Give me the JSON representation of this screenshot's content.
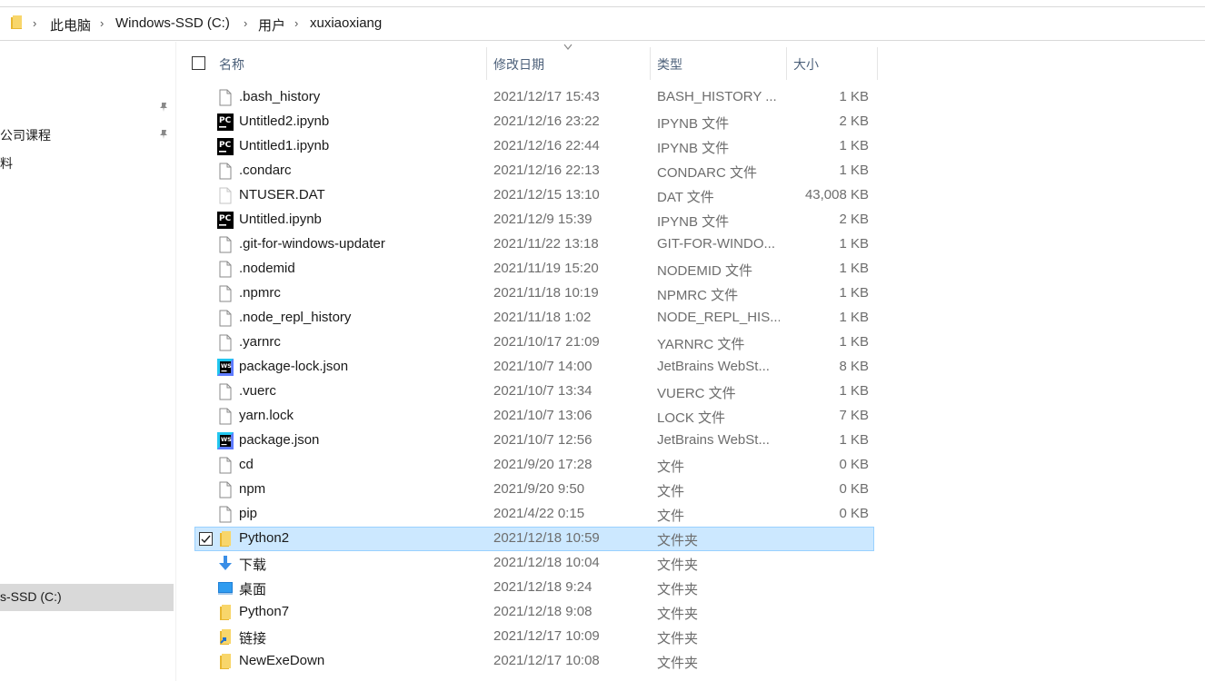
{
  "breadcrumb": [
    "此电脑",
    "Windows-SSD (C:)",
    "用户",
    "xuxiaoxiang"
  ],
  "nav": {
    "items": [
      "公司课程",
      "料"
    ],
    "selected": "s-SSD (C:)"
  },
  "columns": {
    "name": "名称",
    "date": "修改日期",
    "type": "类型",
    "size": "大小"
  },
  "files": [
    {
      "name": ".bash_history",
      "date": "2021/12/17 15:43",
      "type": "BASH_HISTORY ...",
      "size": "1 KB",
      "icon": "generic-file-icon"
    },
    {
      "name": "Untitled2.ipynb",
      "date": "2021/12/16 23:22",
      "type": "IPYNB 文件",
      "size": "2 KB",
      "icon": "pycharm-file-icon"
    },
    {
      "name": "Untitled1.ipynb",
      "date": "2021/12/16 22:44",
      "type": "IPYNB 文件",
      "size": "1 KB",
      "icon": "pycharm-file-icon"
    },
    {
      "name": ".condarc",
      "date": "2021/12/16 22:13",
      "type": "CONDARC 文件",
      "size": "1 KB",
      "icon": "generic-file-icon"
    },
    {
      "name": "NTUSER.DAT",
      "date": "2021/12/15 13:10",
      "type": "DAT 文件",
      "size": "43,008 KB",
      "icon": "system-file-icon"
    },
    {
      "name": "Untitled.ipynb",
      "date": "2021/12/9 15:39",
      "type": "IPYNB 文件",
      "size": "2 KB",
      "icon": "pycharm-file-icon"
    },
    {
      "name": ".git-for-windows-updater",
      "date": "2021/11/22 13:18",
      "type": "GIT-FOR-WINDO...",
      "size": "1 KB",
      "icon": "generic-file-icon"
    },
    {
      "name": ".nodemid",
      "date": "2021/11/19 15:20",
      "type": "NODEMID 文件",
      "size": "1 KB",
      "icon": "generic-file-icon"
    },
    {
      "name": ".npmrc",
      "date": "2021/11/18 10:19",
      "type": "NPMRC 文件",
      "size": "1 KB",
      "icon": "generic-file-icon"
    },
    {
      "name": ".node_repl_history",
      "date": "2021/11/18 1:02",
      "type": "NODE_REPL_HIS...",
      "size": "1 KB",
      "icon": "generic-file-icon"
    },
    {
      "name": ".yarnrc",
      "date": "2021/10/17 21:09",
      "type": "YARNRC 文件",
      "size": "1 KB",
      "icon": "generic-file-icon"
    },
    {
      "name": "package-lock.json",
      "date": "2021/10/7 14:00",
      "type": "JetBrains WebSt...",
      "size": "8 KB",
      "icon": "webstorm-file-icon"
    },
    {
      "name": ".vuerc",
      "date": "2021/10/7 13:34",
      "type": "VUERC 文件",
      "size": "1 KB",
      "icon": "generic-file-icon"
    },
    {
      "name": "yarn.lock",
      "date": "2021/10/7 13:06",
      "type": "LOCK 文件",
      "size": "7 KB",
      "icon": "generic-file-icon"
    },
    {
      "name": "package.json",
      "date": "2021/10/7 12:56",
      "type": "JetBrains WebSt...",
      "size": "1 KB",
      "icon": "webstorm-file-icon"
    },
    {
      "name": "cd",
      "date": "2021/9/20 17:28",
      "type": "文件",
      "size": "0 KB",
      "icon": "generic-file-icon"
    },
    {
      "name": "npm",
      "date": "2021/9/20 9:50",
      "type": "文件",
      "size": "0 KB",
      "icon": "generic-file-icon"
    },
    {
      "name": "pip",
      "date": "2021/4/22 0:15",
      "type": "文件",
      "size": "0 KB",
      "icon": "generic-file-icon"
    },
    {
      "name": "Python2",
      "date": "2021/12/18 10:59",
      "type": "文件夹",
      "size": "",
      "icon": "folder-icon",
      "selected": true
    },
    {
      "name": "下载",
      "date": "2021/12/18 10:04",
      "type": "文件夹",
      "size": "",
      "icon": "download-folder-icon"
    },
    {
      "name": "桌面",
      "date": "2021/12/18 9:24",
      "type": "文件夹",
      "size": "",
      "icon": "desktop-folder-icon"
    },
    {
      "name": "Python7",
      "date": "2021/12/18 9:08",
      "type": "文件夹",
      "size": "",
      "icon": "folder-icon"
    },
    {
      "name": "链接",
      "date": "2021/12/17 10:09",
      "type": "文件夹",
      "size": "",
      "icon": "links-folder-icon"
    },
    {
      "name": "NewExeDown",
      "date": "2021/12/17 10:08",
      "type": "文件夹",
      "size": "",
      "icon": "folder-icon"
    }
  ],
  "colors": {
    "selection_bg": "#cce8ff",
    "selection_border": "#99d1ff",
    "header_text": "#4c607a",
    "secondary_text": "#6d6d6d"
  }
}
